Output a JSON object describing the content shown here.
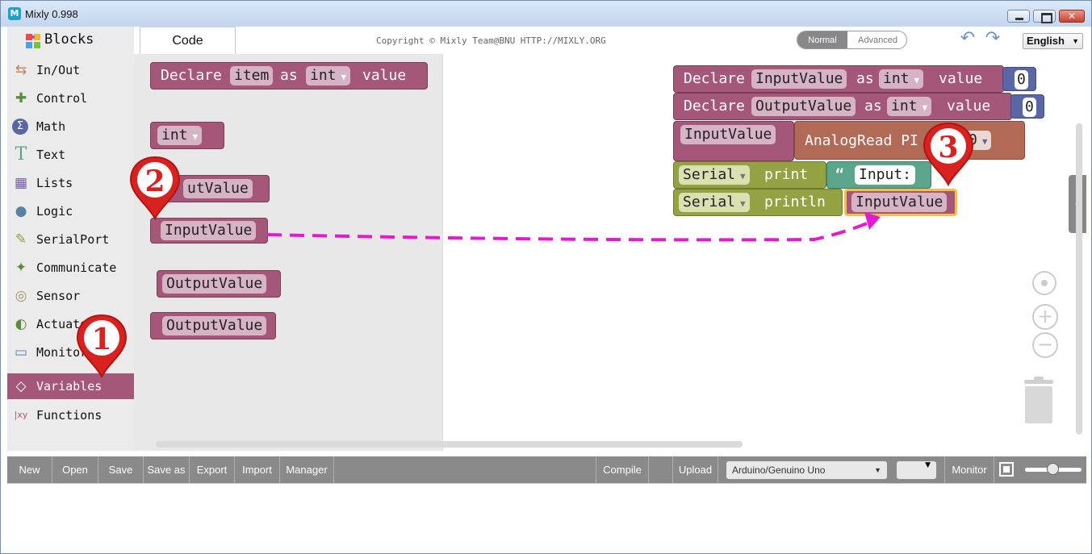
{
  "window": {
    "title": "Mixly 0.998",
    "app_icon": "mixly-icon"
  },
  "toolbox": {
    "title": "Blocks",
    "categories": [
      {
        "label": "In/Out",
        "icon": "arrows-icon",
        "color": "#c27f5a"
      },
      {
        "label": "Control",
        "icon": "gamepad-icon",
        "color": "#5b8d3a"
      },
      {
        "label": "Math",
        "icon": "sigma-icon",
        "color": "#5b67a5"
      },
      {
        "label": "Text",
        "icon": "text-T-icon",
        "color": "#5ba58c"
      },
      {
        "label": "Lists",
        "icon": "list-blocks-icon",
        "color": "#745ba5"
      },
      {
        "label": "Logic",
        "icon": "bulb-icon",
        "color": "#5b80a5"
      },
      {
        "label": "SerialPort",
        "icon": "pen-icon",
        "color": "#94a243"
      },
      {
        "label": "Communicate",
        "icon": "satellite-icon",
        "color": "#5b8d3a"
      },
      {
        "label": "Sensor",
        "icon": "sensor-icon",
        "color": "#a5935b"
      },
      {
        "label": "Actuator",
        "icon": "actuator-icon",
        "color": "#5b8d3a"
      },
      {
        "label": "Monitor",
        "icon": "monitor-icon",
        "color": "#5b80a5"
      },
      {
        "label": "Variables",
        "icon": "unity-icon",
        "color": "#a5577a",
        "selected": true
      },
      {
        "label": "Functions",
        "icon": "function-xy-icon",
        "color": "#a5577a"
      }
    ]
  },
  "header": {
    "tab_code": "Code",
    "copyright": "Copyright © Mixly Team@BNU HTTP://MIXLY.ORG",
    "mode_normal": "Normal",
    "mode_advanced": "Advanced",
    "language": "English"
  },
  "flyout": {
    "declare": {
      "w1": "Declare",
      "name": "item",
      "w2": "as",
      "type": "int",
      "w3": "value"
    },
    "type_block": "int",
    "set_var_partial": "utValue",
    "get_input": "InputValue",
    "get_output1": "OutputValue",
    "get_output2": "OutputValue"
  },
  "program": {
    "declare1": {
      "w1": "Declare",
      "name": "InputValue",
      "w2": "as",
      "type": "int",
      "w3": "value",
      "num": "0"
    },
    "declare2": {
      "w1": "Declare",
      "name": "OutputValue",
      "w2": "as",
      "type": "int",
      "w3": "value",
      "num": "0"
    },
    "assign": {
      "var": "InputValue",
      "read": "AnalogRead PI",
      "pin_partial": "0"
    },
    "print": {
      "port": "Serial",
      "fn": "print",
      "quote": "“",
      "text": "Input:"
    },
    "println": {
      "port": "Serial",
      "fn": "println",
      "var": "InputValue"
    }
  },
  "markers": {
    "m1": "1",
    "m2": "2",
    "m3": "3"
  },
  "bottombar": {
    "buttons": [
      "New",
      "Open",
      "Save",
      "Save as",
      "Export",
      "Import",
      "Manager"
    ],
    "compile": "Compile",
    "upload": "Upload",
    "board": "Arduino/Genuino Uno",
    "monitor": "Monitor"
  },
  "colors": {
    "variables": "#a5577a",
    "math": "#5b67a5",
    "serial": "#94a243",
    "text": "#5ba58c",
    "analog": "#b06a55",
    "arrow": "#e21bd0",
    "marker": "#d9211f"
  }
}
